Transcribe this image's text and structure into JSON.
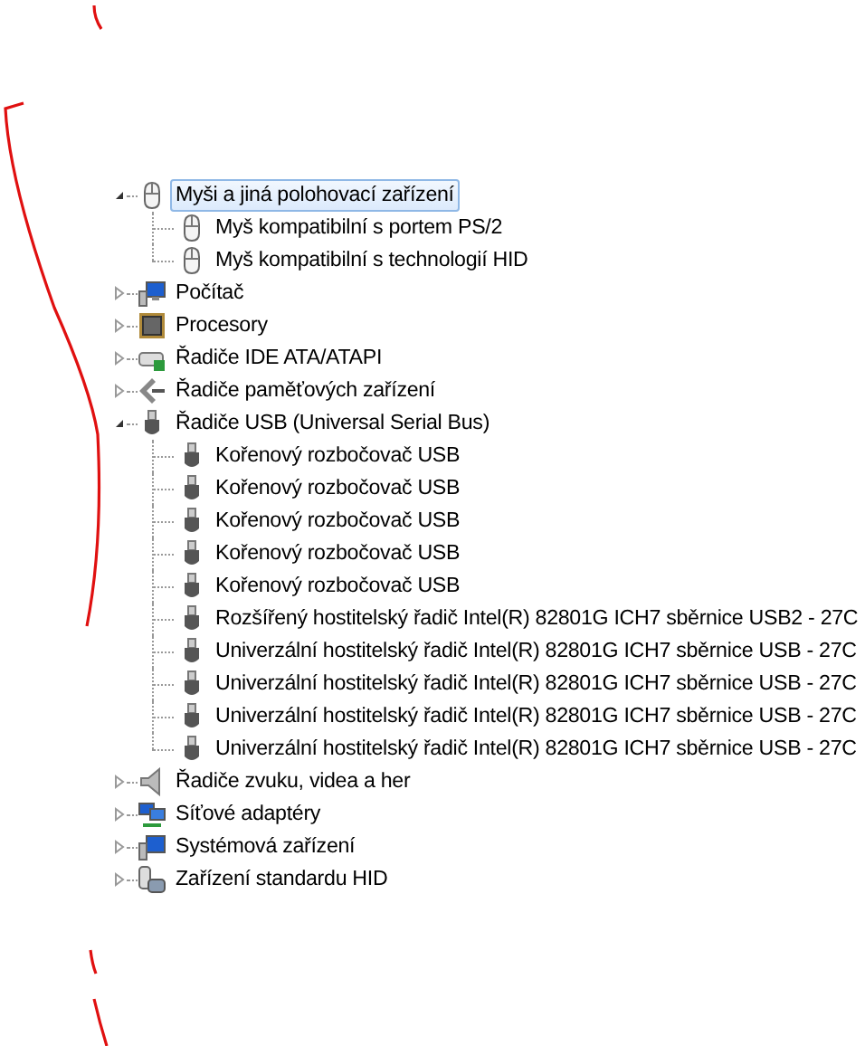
{
  "tree": [
    {
      "label": "Myši a jiná polohovací zařízení",
      "kind": "mouse",
      "expanded": true,
      "selected": true,
      "children": [
        {
          "label": "Myš kompatibilní s portem PS/2",
          "kind": "mouse",
          "selected": false
        },
        {
          "label": "Myš kompatibilní s technologií HID",
          "kind": "mouse",
          "selected": false
        }
      ]
    },
    {
      "label": "Počítač",
      "kind": "computer",
      "expanded": false,
      "selected": false
    },
    {
      "label": "Procesory",
      "kind": "processor",
      "expanded": false,
      "selected": false
    },
    {
      "label": "Řadiče IDE ATA/ATAPI",
      "kind": "drive",
      "expanded": false,
      "selected": false
    },
    {
      "label": "Řadiče paměťových zařízení",
      "kind": "storage",
      "expanded": false,
      "selected": false
    },
    {
      "label": "Řadiče USB (Universal Serial Bus)",
      "kind": "usb",
      "expanded": true,
      "selected": false,
      "children": [
        {
          "label": "Kořenový rozbočovač USB",
          "kind": "usb",
          "selected": false
        },
        {
          "label": "Kořenový rozbočovač USB",
          "kind": "usb",
          "selected": false
        },
        {
          "label": "Kořenový rozbočovač USB",
          "kind": "usb",
          "selected": false
        },
        {
          "label": "Kořenový rozbočovač USB",
          "kind": "usb",
          "selected": false
        },
        {
          "label": "Kořenový rozbočovač USB",
          "kind": "usb",
          "selected": false
        },
        {
          "label": "Rozšířený hostitelský řadič Intel(R) 82801G ICH7 sběrnice USB2 - 27C",
          "kind": "usb",
          "selected": false
        },
        {
          "label": "Univerzální hostitelský řadič Intel(R) 82801G ICH7 sběrnice USB - 27C",
          "kind": "usb",
          "selected": false
        },
        {
          "label": "Univerzální hostitelský řadič Intel(R) 82801G ICH7 sběrnice USB - 27C",
          "kind": "usb",
          "selected": false
        },
        {
          "label": "Univerzální hostitelský řadič Intel(R) 82801G ICH7 sběrnice USB - 27C",
          "kind": "usb",
          "selected": false
        },
        {
          "label": "Univerzální hostitelský řadič Intel(R) 82801G ICH7 sběrnice USB - 27C",
          "kind": "usb",
          "selected": false
        }
      ]
    },
    {
      "label": "Řadiče zvuku, videa a her",
      "kind": "sound",
      "expanded": false,
      "selected": false
    },
    {
      "label": "Síťové adaptéry",
      "kind": "network",
      "expanded": false,
      "selected": false
    },
    {
      "label": "Systémová zařízení",
      "kind": "system",
      "expanded": false,
      "selected": false
    },
    {
      "label": "Zařízení standardu HID",
      "kind": "hid",
      "expanded": false,
      "selected": false
    }
  ]
}
